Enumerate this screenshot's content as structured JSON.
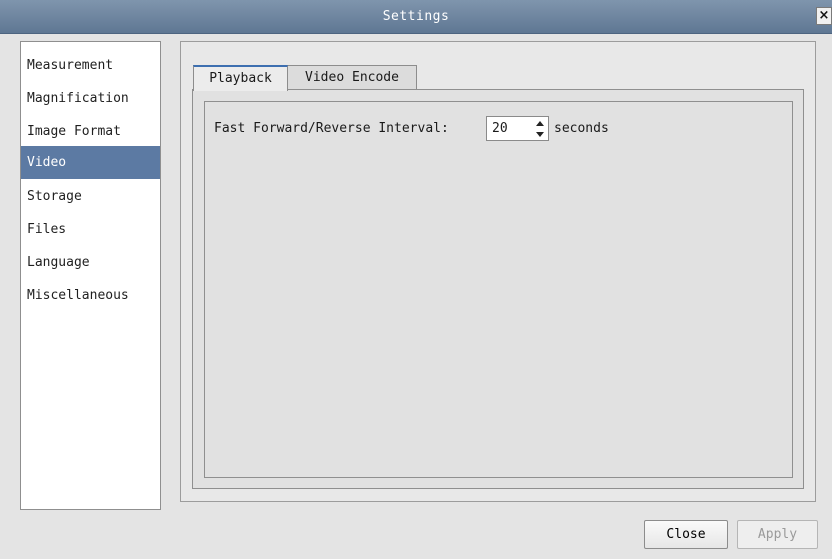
{
  "window": {
    "title": "Settings",
    "close_glyph": "×"
  },
  "sidebar": {
    "items": [
      {
        "label": "Measurement",
        "selected": false
      },
      {
        "label": "Magnification",
        "selected": false
      },
      {
        "label": "Image Format",
        "selected": false
      },
      {
        "label": "Video",
        "selected": true
      },
      {
        "label": "Storage",
        "selected": false
      },
      {
        "label": "Files",
        "selected": false
      },
      {
        "label": "Language",
        "selected": false
      },
      {
        "label": "Miscellaneous",
        "selected": false
      }
    ]
  },
  "tabs": [
    {
      "label": "Playback",
      "active": true
    },
    {
      "label": "Video Encode",
      "active": false
    }
  ],
  "playback": {
    "interval_label": "Fast Forward/Reverse Interval:",
    "interval_value": "20",
    "interval_units": "seconds"
  },
  "footer": {
    "close_label": "Close",
    "apply_label": "Apply",
    "apply_enabled": false
  },
  "colors": {
    "selection": "#5c7aa3",
    "titlebar": "#6a819c"
  },
  "icons": {
    "close": "close-icon",
    "spin_up": "arrow-up-icon",
    "spin_down": "arrow-down-icon"
  }
}
